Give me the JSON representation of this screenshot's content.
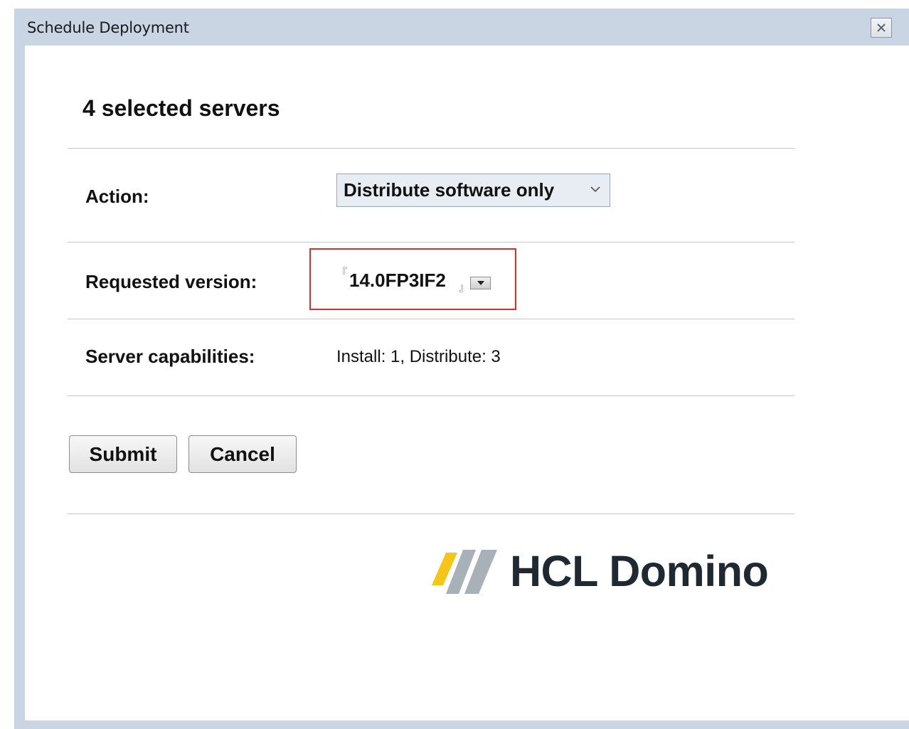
{
  "window": {
    "title": "Schedule Deployment"
  },
  "heading": "4 selected servers",
  "form": {
    "action_label": "Action:",
    "action_value": "Distribute software only",
    "version_label": "Requested version:",
    "version_value": "14.0FP3IF2",
    "capabilities_label": "Server capabilities:",
    "capabilities_value": "Install: 1, Distribute: 3"
  },
  "buttons": {
    "submit": "Submit",
    "cancel": "Cancel"
  },
  "brand": {
    "name": "HCL Domino",
    "colors": {
      "yellow": "#f5c518",
      "gray": "#a9b1b8",
      "text": "#1f2932"
    }
  },
  "colors": {
    "titlebar": "#c9d5e3",
    "highlight_border": "#e02d2d"
  },
  "icons": {
    "close": "close-icon",
    "dropdown": "chevron-down-icon",
    "logo": "hcl-logo-mark"
  }
}
